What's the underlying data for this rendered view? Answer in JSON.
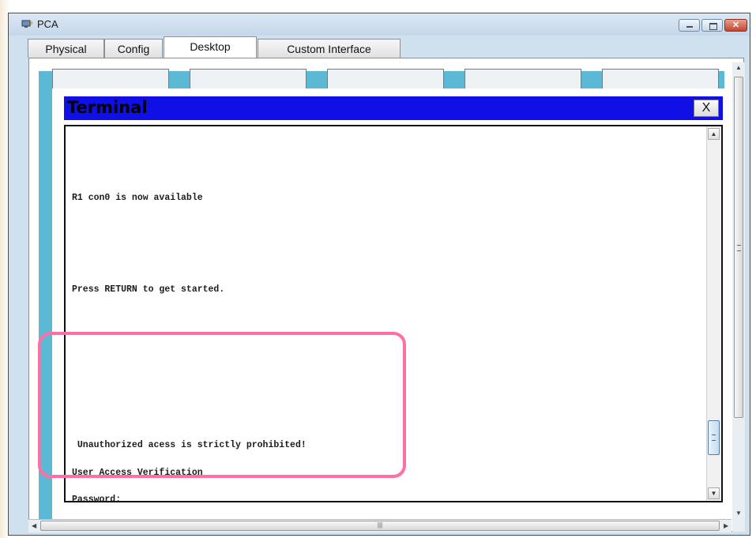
{
  "window": {
    "title": "PCA",
    "minimize_glyph": "",
    "maximize_glyph": "",
    "close_glyph": "✕"
  },
  "tabs": [
    {
      "label": "Physical"
    },
    {
      "label": "Config"
    },
    {
      "label": "Desktop",
      "active": true
    },
    {
      "label": "Custom Interface"
    }
  ],
  "terminal": {
    "title": "Terminal",
    "close_label": "X",
    "lines": [
      "R1 con0 is now available",
      "Press RETURN to get started.",
      " Unauthorized acess is strictly prohibited!",
      "User Access Verification",
      "Password:"
    ]
  },
  "scrollbar": {
    "up_arrow": "▲",
    "down_arrow": "▼",
    "grip": "|||"
  },
  "colors": {
    "terminal_titlebar": "#0f0fe6",
    "desktop_background": "#5bb9d6",
    "highlight": "#ff6fa3"
  },
  "icons": [
    "app-icon",
    "close-icon",
    "minimize-icon",
    "maximize-icon"
  ]
}
